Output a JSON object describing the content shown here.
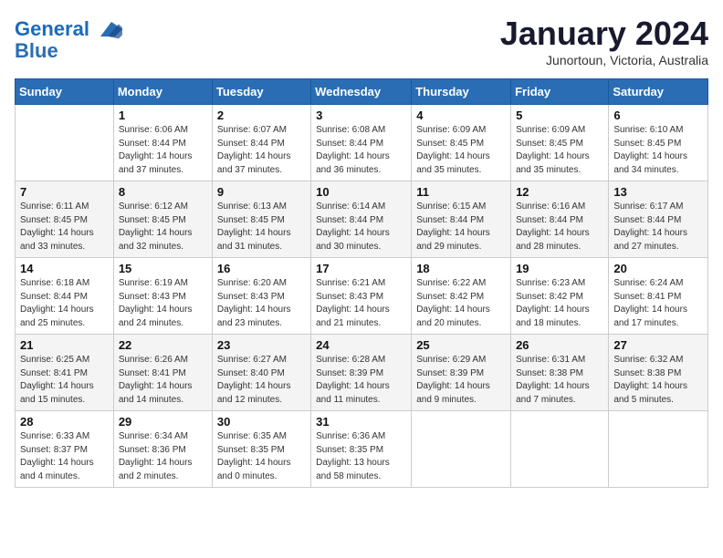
{
  "header": {
    "logo_line1": "General",
    "logo_line2": "Blue",
    "month": "January 2024",
    "location": "Junortoun, Victoria, Australia"
  },
  "weekdays": [
    "Sunday",
    "Monday",
    "Tuesday",
    "Wednesday",
    "Thursday",
    "Friday",
    "Saturday"
  ],
  "weeks": [
    [
      {
        "day": "",
        "info": ""
      },
      {
        "day": "1",
        "info": "Sunrise: 6:06 AM\nSunset: 8:44 PM\nDaylight: 14 hours\nand 37 minutes."
      },
      {
        "day": "2",
        "info": "Sunrise: 6:07 AM\nSunset: 8:44 PM\nDaylight: 14 hours\nand 37 minutes."
      },
      {
        "day": "3",
        "info": "Sunrise: 6:08 AM\nSunset: 8:44 PM\nDaylight: 14 hours\nand 36 minutes."
      },
      {
        "day": "4",
        "info": "Sunrise: 6:09 AM\nSunset: 8:45 PM\nDaylight: 14 hours\nand 35 minutes."
      },
      {
        "day": "5",
        "info": "Sunrise: 6:09 AM\nSunset: 8:45 PM\nDaylight: 14 hours\nand 35 minutes."
      },
      {
        "day": "6",
        "info": "Sunrise: 6:10 AM\nSunset: 8:45 PM\nDaylight: 14 hours\nand 34 minutes."
      }
    ],
    [
      {
        "day": "7",
        "info": "Sunrise: 6:11 AM\nSunset: 8:45 PM\nDaylight: 14 hours\nand 33 minutes."
      },
      {
        "day": "8",
        "info": "Sunrise: 6:12 AM\nSunset: 8:45 PM\nDaylight: 14 hours\nand 32 minutes."
      },
      {
        "day": "9",
        "info": "Sunrise: 6:13 AM\nSunset: 8:45 PM\nDaylight: 14 hours\nand 31 minutes."
      },
      {
        "day": "10",
        "info": "Sunrise: 6:14 AM\nSunset: 8:44 PM\nDaylight: 14 hours\nand 30 minutes."
      },
      {
        "day": "11",
        "info": "Sunrise: 6:15 AM\nSunset: 8:44 PM\nDaylight: 14 hours\nand 29 minutes."
      },
      {
        "day": "12",
        "info": "Sunrise: 6:16 AM\nSunset: 8:44 PM\nDaylight: 14 hours\nand 28 minutes."
      },
      {
        "day": "13",
        "info": "Sunrise: 6:17 AM\nSunset: 8:44 PM\nDaylight: 14 hours\nand 27 minutes."
      }
    ],
    [
      {
        "day": "14",
        "info": "Sunrise: 6:18 AM\nSunset: 8:44 PM\nDaylight: 14 hours\nand 25 minutes."
      },
      {
        "day": "15",
        "info": "Sunrise: 6:19 AM\nSunset: 8:43 PM\nDaylight: 14 hours\nand 24 minutes."
      },
      {
        "day": "16",
        "info": "Sunrise: 6:20 AM\nSunset: 8:43 PM\nDaylight: 14 hours\nand 23 minutes."
      },
      {
        "day": "17",
        "info": "Sunrise: 6:21 AM\nSunset: 8:43 PM\nDaylight: 14 hours\nand 21 minutes."
      },
      {
        "day": "18",
        "info": "Sunrise: 6:22 AM\nSunset: 8:42 PM\nDaylight: 14 hours\nand 20 minutes."
      },
      {
        "day": "19",
        "info": "Sunrise: 6:23 AM\nSunset: 8:42 PM\nDaylight: 14 hours\nand 18 minutes."
      },
      {
        "day": "20",
        "info": "Sunrise: 6:24 AM\nSunset: 8:41 PM\nDaylight: 14 hours\nand 17 minutes."
      }
    ],
    [
      {
        "day": "21",
        "info": "Sunrise: 6:25 AM\nSunset: 8:41 PM\nDaylight: 14 hours\nand 15 minutes."
      },
      {
        "day": "22",
        "info": "Sunrise: 6:26 AM\nSunset: 8:41 PM\nDaylight: 14 hours\nand 14 minutes."
      },
      {
        "day": "23",
        "info": "Sunrise: 6:27 AM\nSunset: 8:40 PM\nDaylight: 14 hours\nand 12 minutes."
      },
      {
        "day": "24",
        "info": "Sunrise: 6:28 AM\nSunset: 8:39 PM\nDaylight: 14 hours\nand 11 minutes."
      },
      {
        "day": "25",
        "info": "Sunrise: 6:29 AM\nSunset: 8:39 PM\nDaylight: 14 hours\nand 9 minutes."
      },
      {
        "day": "26",
        "info": "Sunrise: 6:31 AM\nSunset: 8:38 PM\nDaylight: 14 hours\nand 7 minutes."
      },
      {
        "day": "27",
        "info": "Sunrise: 6:32 AM\nSunset: 8:38 PM\nDaylight: 14 hours\nand 5 minutes."
      }
    ],
    [
      {
        "day": "28",
        "info": "Sunrise: 6:33 AM\nSunset: 8:37 PM\nDaylight: 14 hours\nand 4 minutes."
      },
      {
        "day": "29",
        "info": "Sunrise: 6:34 AM\nSunset: 8:36 PM\nDaylight: 14 hours\nand 2 minutes."
      },
      {
        "day": "30",
        "info": "Sunrise: 6:35 AM\nSunset: 8:35 PM\nDaylight: 14 hours\nand 0 minutes."
      },
      {
        "day": "31",
        "info": "Sunrise: 6:36 AM\nSunset: 8:35 PM\nDaylight: 13 hours\nand 58 minutes."
      },
      {
        "day": "",
        "info": ""
      },
      {
        "day": "",
        "info": ""
      },
      {
        "day": "",
        "info": ""
      }
    ]
  ]
}
